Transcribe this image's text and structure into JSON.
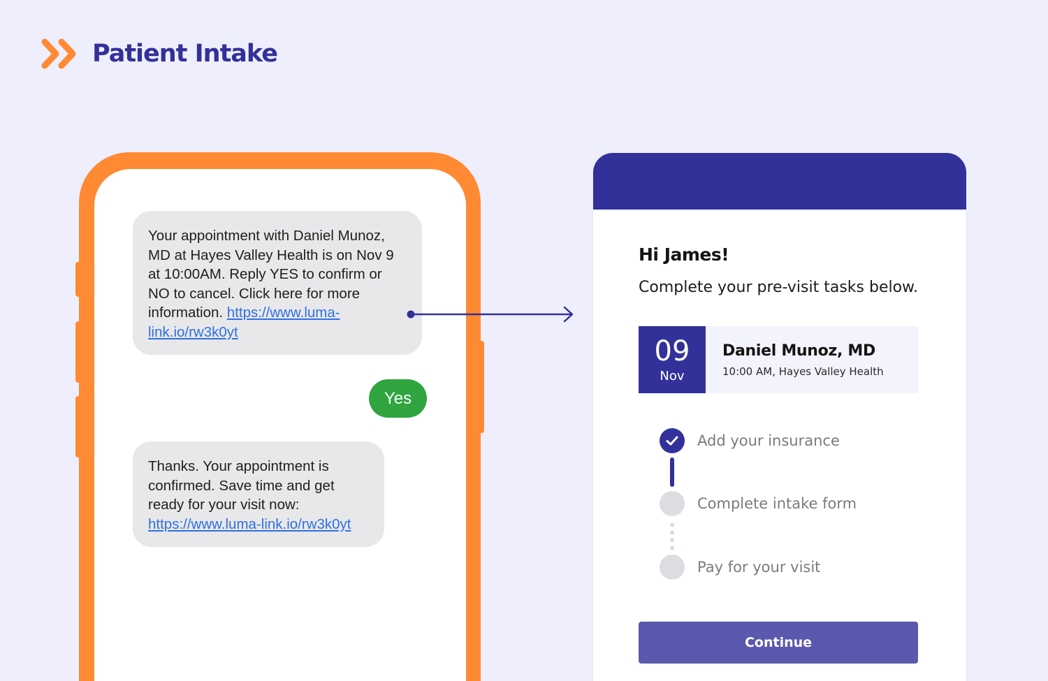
{
  "header": {
    "title": "Patient Intake",
    "logo_icon": "double-chevron-right-icon",
    "logo_color": "#ff8a33",
    "title_color": "#32319a"
  },
  "phone": {
    "frame_color": "#ff8a33",
    "messages": [
      {
        "sender": "clinic",
        "text": "Your appointment with Daniel Munoz, MD at Hayes Valley Health is on Nov 9 at 10:00AM. Reply YES to confirm or NO to cancel. Click here for more information. ",
        "link": "https://www.luma-link.io/rw3k0yt"
      },
      {
        "sender": "patient",
        "text": "Yes"
      },
      {
        "sender": "clinic",
        "text": "Thanks. Your appointment is confirmed. Save time and get ready for your visit now: ",
        "link": "https://www.luma-link.io/rw3k0yt"
      }
    ],
    "reply_color": "#2fa43f"
  },
  "intake": {
    "greeting": "Hi James!",
    "subtitle": "Complete your pre-visit tasks below.",
    "appointment": {
      "day": "09",
      "month": "Nov",
      "doctor": "Daniel Munoz, MD",
      "detail": "10:00 AM, Hayes Valley Health"
    },
    "tasks": [
      {
        "label": "Add your insurance",
        "status": "complete"
      },
      {
        "label": "Complete intake form",
        "status": "pending"
      },
      {
        "label": "Pay for your visit",
        "status": "pending"
      }
    ],
    "continue_label": "Continue",
    "accent_color": "#32319a",
    "button_color": "#5a59ad"
  }
}
